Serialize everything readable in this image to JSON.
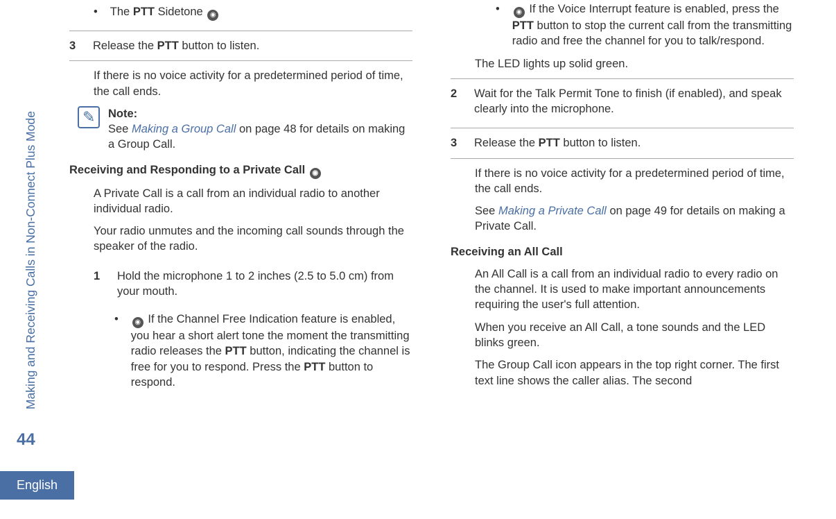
{
  "sidebar": {
    "chapter": "Making and Receiving Calls in Non-Connect Plus Mode",
    "page_number": "44",
    "language": "English"
  },
  "left": {
    "bullet1_pre": "The ",
    "bullet1_bold": "PTT",
    "bullet1_post": " Sidetone ",
    "step3_pre": "Release the ",
    "step3_bold": "PTT",
    "step3_post": " button to listen.",
    "step3_num": "3",
    "para_noactivity": "If there is no voice activity for a predetermined period of time, the call ends.",
    "note_label": "Note:",
    "note_pre": "See ",
    "note_link": "Making a Group Call",
    "note_post": " on page 48 for details on making a Group Call.",
    "heading_private": "Receiving and Responding to a Private Call ",
    "private_p1": "A Private Call is a call from an individual radio to another individual radio.",
    "private_p2": "Your radio unmutes and the incoming call sounds through the speaker of the radio.",
    "step1_num": "1",
    "step1_text": "Hold the microphone 1 to 2 inches (2.5 to 5.0 cm) from your mouth.",
    "sub_pre": " If the Channel Free Indication feature is enabled, you hear a short alert tone the moment the transmitting radio releases the ",
    "sub_bold1": "PTT",
    "sub_mid": " button, indicating the channel is free for you to respond. Press the ",
    "sub_bold2": "PTT",
    "sub_end": " button to respond."
  },
  "right": {
    "sub_pre": " If the Voice Interrupt feature is enabled, press the ",
    "sub_bold": "PTT",
    "sub_post": " button to stop the current call from the transmitting radio and free the channel for you to talk/respond.",
    "led_text": "The LED lights up solid green.",
    "step2_num": "2",
    "step2_text": "Wait for the Talk Permit Tone to finish (if enabled), and speak clearly into the microphone.",
    "step3_num": "3",
    "step3_pre": "Release the ",
    "step3_bold": "PTT",
    "step3_post": " button to listen.",
    "para_noactivity": "If there is no voice activity for a predetermined period of time, the call ends.",
    "see_pre": "See ",
    "see_link": "Making a Private Call",
    "see_post": " on page 49 for details on making a Private Call.",
    "heading_all": "Receiving an All Call",
    "all_p1": "An All Call is a call from an individual radio to every radio on the channel. It is used to make important announcements requiring the user's full attention.",
    "all_p2": "When you receive an All Call, a tone sounds and the LED blinks green.",
    "all_p3": "The Group Call icon appears in the top right corner. The first text line shows the caller alias. The second"
  }
}
